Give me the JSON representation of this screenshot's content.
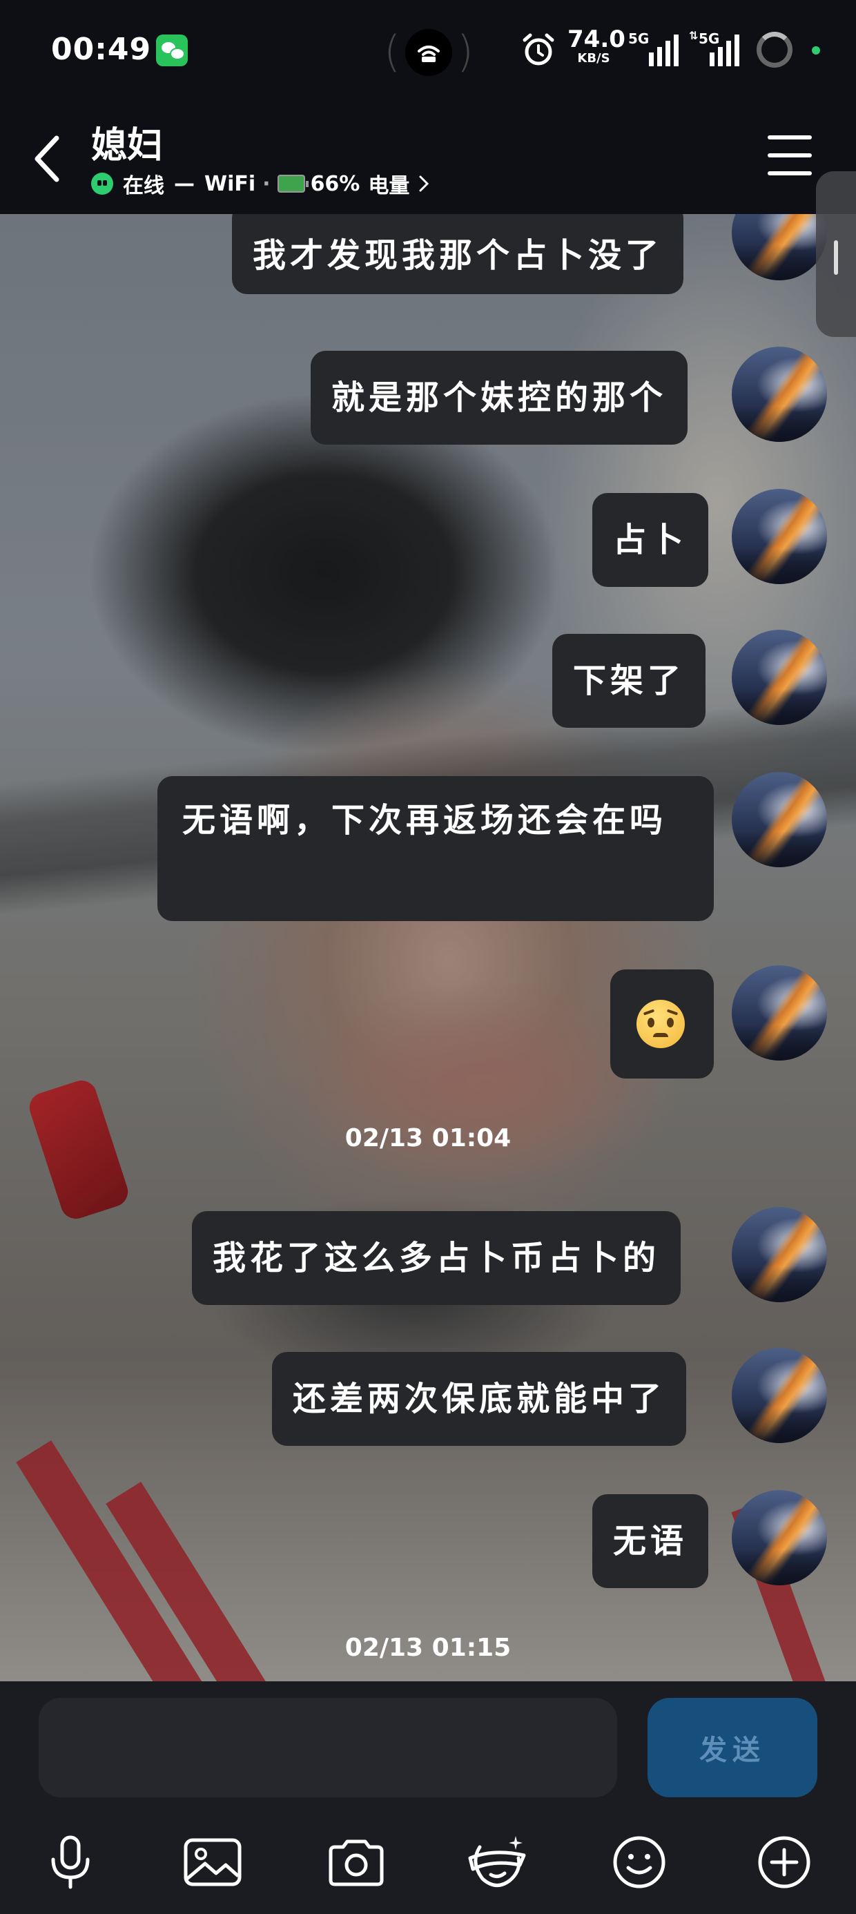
{
  "status_bar": {
    "time": "00:49",
    "net_speed_value": "74.0",
    "net_speed_unit": "KB/S",
    "sim1_label": "5G",
    "sim2_label": "5G"
  },
  "header": {
    "contact_name": "媳妇",
    "online_status": "在线",
    "separator": "—",
    "network": "WiFi",
    "dot": "·",
    "battery": "66%",
    "battery_label": "电量"
  },
  "messages": [
    {
      "text": "我才发现我那个占卜没了"
    },
    {
      "text": "就是那个妹控的那个"
    },
    {
      "text": "占卜"
    },
    {
      "text": "下架了"
    },
    {
      "text": "无语啊，下次再返场还会在吗"
    },
    {
      "text": "",
      "emoji": "pleading-face"
    },
    {
      "text": "我花了这么多占卜币占卜的"
    },
    {
      "text": "还差两次保底就能中了"
    },
    {
      "text": "无语"
    }
  ],
  "timestamps": [
    "02/13 01:04",
    "02/13 01:15"
  ],
  "input": {
    "value": "",
    "send_label": "发送"
  },
  "toolbar_icons": [
    "microphone-icon",
    "image-icon",
    "camera-icon",
    "face-effect-icon",
    "emoji-icon",
    "plus-icon"
  ],
  "colors": {
    "bubble": "#26272b",
    "online": "#2ecc71",
    "send_button": "#164e7c",
    "app_bg": "#0d0f14"
  }
}
